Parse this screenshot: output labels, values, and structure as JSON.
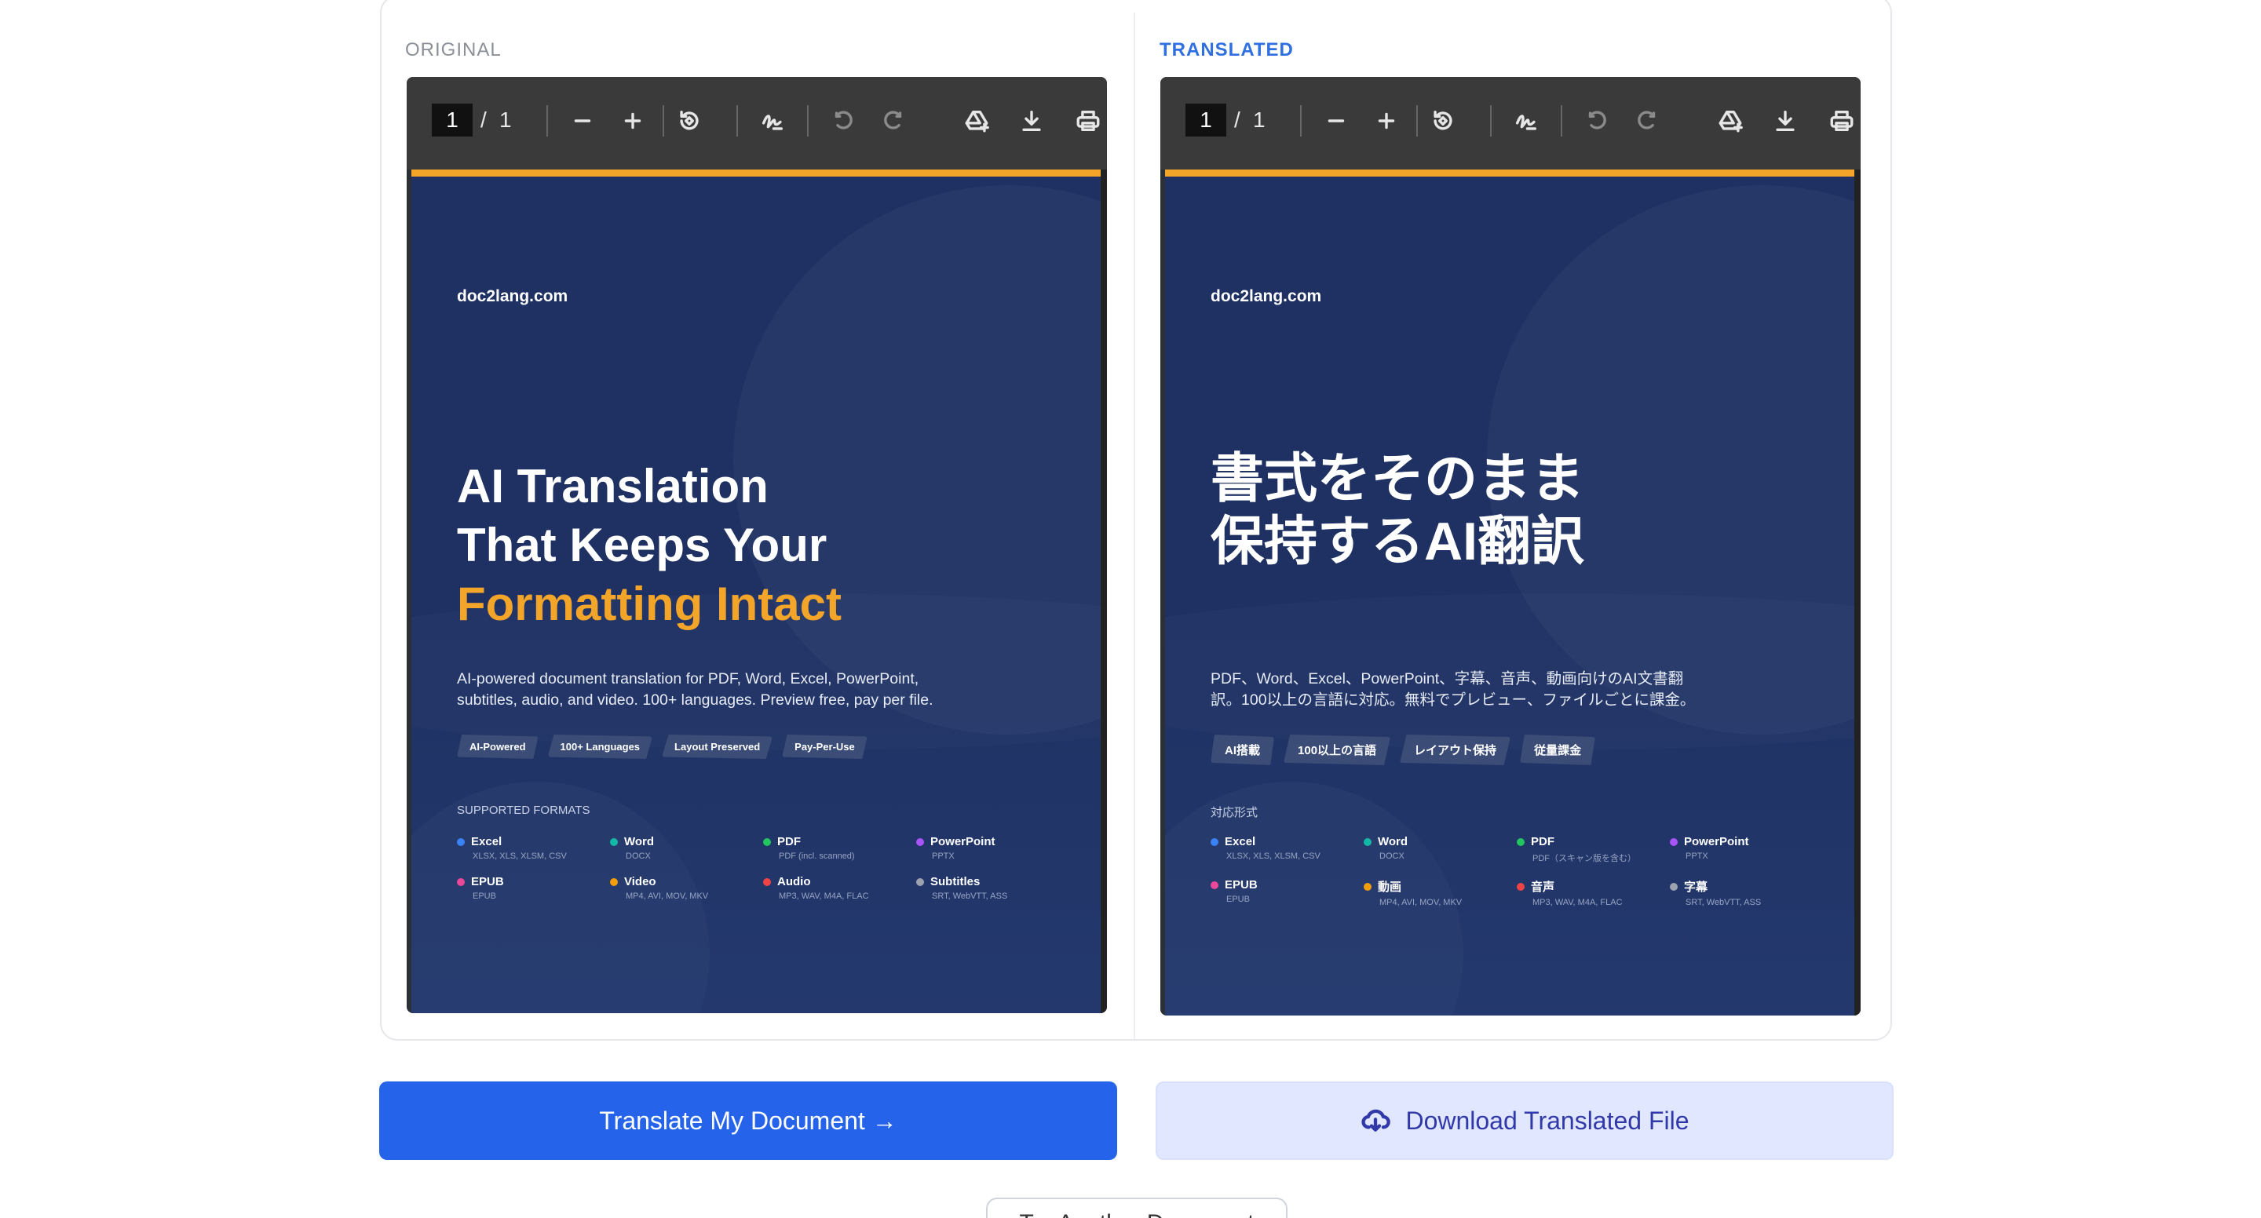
{
  "panes": {
    "original_label": "ORIGINAL",
    "translated_label": "TRANSLATED"
  },
  "viewer": {
    "current_page": "1",
    "separator": "/",
    "total_pages": "1"
  },
  "original": {
    "site": "doc2lang.com",
    "title_line1": "AI Translation",
    "title_line2": "That Keeps Your",
    "title_accent": "Formatting Intact",
    "description": "AI-powered document translation for PDF, Word, Excel, PowerPoint, subtitles, audio, and video. 100+ languages. Preview free, pay per file.",
    "chips": [
      "AI-Powered",
      "100+ Languages",
      "Layout Preserved",
      "Pay-Per-Use"
    ],
    "formats_title": "SUPPORTED FORMATS",
    "formats": [
      {
        "name": "Excel",
        "sub": "XLSX, XLS, XLSM, CSV",
        "color": "#3b82f6"
      },
      {
        "name": "Word",
        "sub": "DOCX",
        "color": "#14b8a6"
      },
      {
        "name": "PDF",
        "sub": "PDF (incl. scanned)",
        "color": "#22c55e"
      },
      {
        "name": "PowerPoint",
        "sub": "PPTX",
        "color": "#a855f7"
      },
      {
        "name": "EPUB",
        "sub": "EPUB",
        "color": "#ec4899"
      },
      {
        "name": "Video",
        "sub": "MP4, AVI, MOV, MKV",
        "color": "#f59e0b"
      },
      {
        "name": "Audio",
        "sub": "MP3, WAV, M4A, FLAC",
        "color": "#ef4444"
      },
      {
        "name": "Subtitles",
        "sub": "SRT, WebVTT, ASS",
        "color": "#9ca3af"
      }
    ]
  },
  "translated": {
    "site": "doc2lang.com",
    "title_line1": "書式をそのまま",
    "title_line2": "保持するAI翻訳",
    "description": "PDF、Word、Excel、PowerPoint、字幕、音声、動画向けのAI文書翻訳。100以上の言語に対応。無料でプレビュー、ファイルごとに課金。",
    "chips": [
      "AI搭載",
      "100以上の言語",
      "レイアウト保持",
      "従量課金"
    ],
    "formats_title": "対応形式",
    "formats": [
      {
        "name": "Excel",
        "sub": "XLSX, XLS, XLSM, CSV",
        "color": "#3b82f6"
      },
      {
        "name": "Word",
        "sub": "DOCX",
        "color": "#14b8a6"
      },
      {
        "name": "PDF",
        "sub": "PDF（スキャン版を含む）",
        "color": "#22c55e"
      },
      {
        "name": "PowerPoint",
        "sub": "PPTX",
        "color": "#a855f7"
      },
      {
        "name": "EPUB",
        "sub": "EPUB",
        "color": "#ec4899"
      },
      {
        "name": "動画",
        "sub": "MP4, AVI, MOV, MKV",
        "color": "#f59e0b"
      },
      {
        "name": "音声",
        "sub": "MP3, WAV, M4A, FLAC",
        "color": "#ef4444"
      },
      {
        "name": "字幕",
        "sub": "SRT, WebVTT, ASS",
        "color": "#9ca3af"
      }
    ]
  },
  "actions": {
    "translate_label": "Translate My Document →",
    "download_label": "Download Translated File",
    "another_label": "Try Another Document"
  }
}
